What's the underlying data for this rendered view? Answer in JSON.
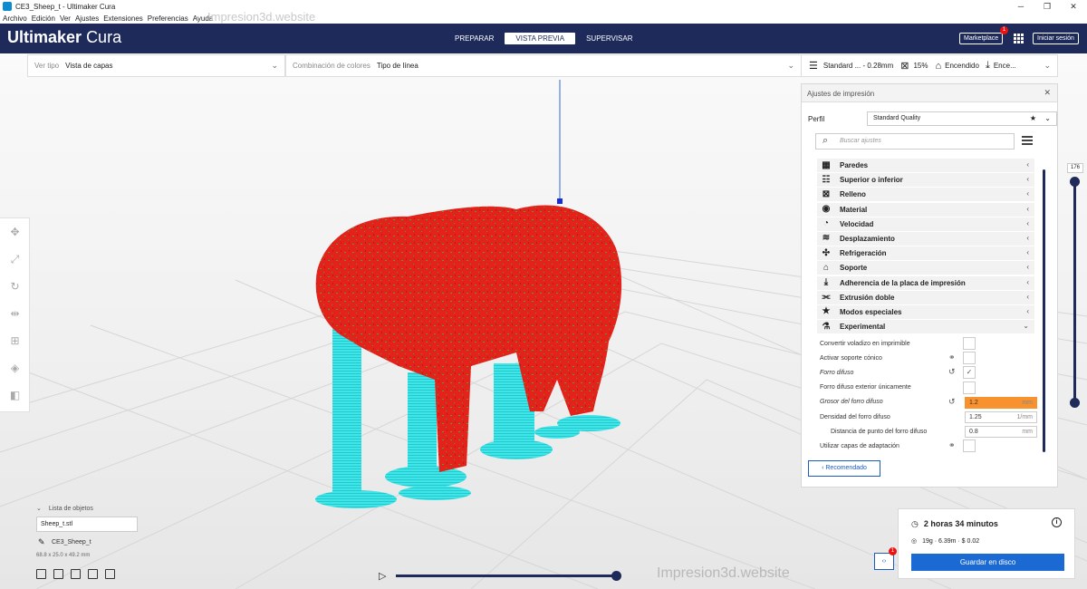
{
  "window": {
    "title": "CE3_Sheep_t - Ultimaker Cura",
    "watermark": "Impresion3d.website"
  },
  "menu": [
    "Archivo",
    "Edición",
    "Ver",
    "Ajustes",
    "Extensiones",
    "Preferencias",
    "Ayuda"
  ],
  "header": {
    "brand_bold": "Ultimaker",
    "brand_light": "Cura",
    "tabs": [
      "PREPARAR",
      "VISTA PREVIA",
      "SUPERVISAR"
    ],
    "active_tab": "VISTA PREVIA",
    "marketplace": "Marketplace",
    "marketplace_badge": "1",
    "signin": "Iniciar sesión"
  },
  "topbar": {
    "view_type_label": "Ver tipo",
    "view_type_value": "Vista de capas",
    "color_scheme_label": "Combinación de colores",
    "color_scheme_value": "Tipo de línea",
    "profile_summary": "Standard ... - 0.28mm",
    "infill": "15%",
    "support": "Encendido",
    "adhesion": "Ence..."
  },
  "panel": {
    "title": "Ajustes de impresión",
    "profile_label": "Perfil",
    "profile_value": "Standard Quality",
    "search_placeholder": "Buscar ajustes",
    "categories": [
      {
        "icon": "walls-icon",
        "glyph": "▦",
        "label": "Paredes",
        "arrow": "‹"
      },
      {
        "icon": "top-bottom-icon",
        "glyph": "☷",
        "label": "Superior o inferior",
        "arrow": "‹"
      },
      {
        "icon": "infill-icon",
        "glyph": "⊠",
        "label": "Relleno",
        "arrow": "‹"
      },
      {
        "icon": "material-icon",
        "glyph": "◉",
        "label": "Material",
        "arrow": "‹"
      },
      {
        "icon": "speed-icon",
        "glyph": "◔",
        "label": "Velocidad",
        "arrow": "‹"
      },
      {
        "icon": "travel-icon",
        "glyph": "≋",
        "label": "Desplazamiento",
        "arrow": "‹"
      },
      {
        "icon": "cooling-icon",
        "glyph": "✣",
        "label": "Refrigeración",
        "arrow": "‹"
      },
      {
        "icon": "support-icon",
        "glyph": "⌂",
        "label": "Soporte",
        "arrow": "‹"
      },
      {
        "icon": "adhesion-icon",
        "glyph": "⤓",
        "label": "Adherencia de la placa de impresión",
        "arrow": "‹"
      },
      {
        "icon": "dual-extrusion-icon",
        "glyph": "⫘",
        "label": "Extrusión doble",
        "arrow": "‹"
      },
      {
        "icon": "special-modes-icon",
        "glyph": "★",
        "label": "Modos especiales",
        "arrow": "‹"
      },
      {
        "icon": "experimental-icon",
        "glyph": "⚗",
        "label": "Experimental",
        "arrow": "⌄"
      }
    ],
    "options": [
      {
        "label": "Convertir voladizo en imprimible",
        "type": "check",
        "checked": "",
        "italic": false
      },
      {
        "label": "Activar soporte cónico",
        "type": "check",
        "checked": "",
        "italic": false,
        "icon": "link-icon"
      },
      {
        "label": "Forro difuso",
        "type": "check",
        "checked": "✓",
        "italic": true,
        "icon": "reset-icon"
      },
      {
        "label": "Forro difuso exterior únicamente",
        "type": "check",
        "checked": "",
        "italic": false
      },
      {
        "label": "Grosor del forro difuso",
        "type": "field",
        "value": "1.2",
        "unit": "mm",
        "italic": true,
        "highlight": true,
        "icon": "reset-icon"
      },
      {
        "label": "Densidad del forro difuso",
        "type": "field",
        "value": "1.25",
        "unit": "1/mm",
        "italic": false
      },
      {
        "label": "Distancia de punto del forro difuso",
        "type": "field",
        "value": "0.8",
        "unit": "mm",
        "italic": false,
        "indent": true
      },
      {
        "label": "Utilizar capas de adaptación",
        "type": "check",
        "checked": "",
        "italic": false,
        "icon": "link-icon"
      }
    ],
    "recommended": "‹  Recomendado"
  },
  "layer_slider": {
    "value": "176"
  },
  "objects": {
    "title": "Lista de objetos",
    "file": "Sheep_t.stl",
    "name": "CE3_Sheep_t",
    "dims": "68.8 x 25.0 x 49.2 mm"
  },
  "output": {
    "time": "2 horas 34 minutos",
    "material": "19g · 6.39m · $ 0.02",
    "save": "Guardar en disco",
    "badge": "1"
  },
  "colors": {
    "header": "#1d2a5a",
    "accent": "#1b6ad3",
    "model": "#e3231b",
    "support": "#3ee6e8"
  }
}
